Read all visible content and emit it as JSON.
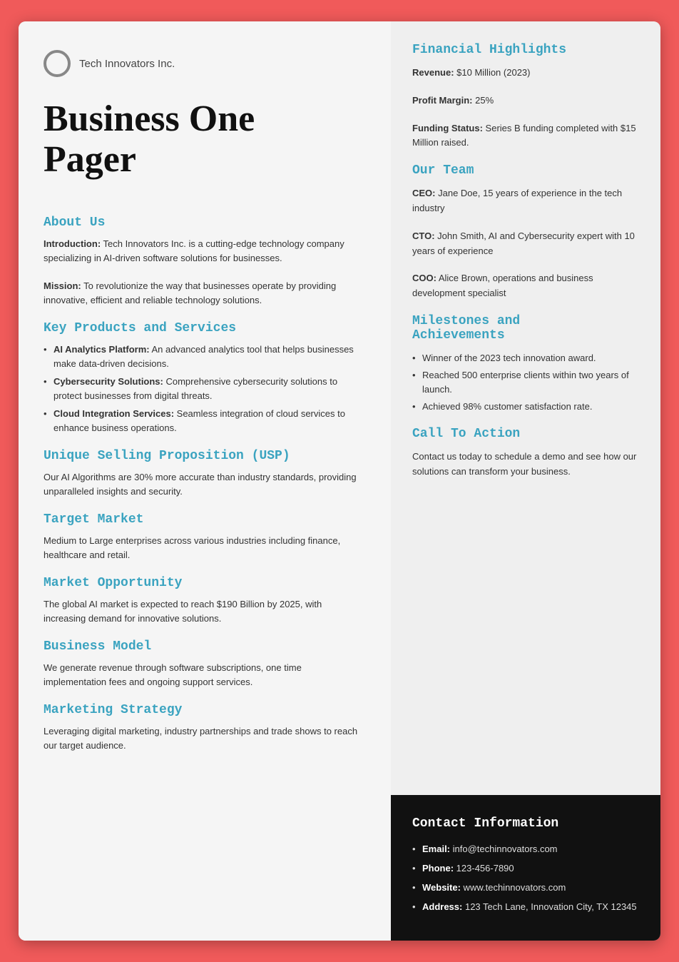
{
  "company": {
    "name": "Tech Innovators Inc.",
    "logo_alt": "circle logo"
  },
  "header": {
    "title_line1": "Business One",
    "title_line2": "Pager"
  },
  "left": {
    "about_us": {
      "heading": "About Us",
      "intro_label": "Introduction:",
      "intro_text": "Tech Innovators Inc. is a cutting-edge technology company specializing in AI-driven software solutions for businesses.",
      "mission_label": "Mission:",
      "mission_text": "To revolutionize the way that businesses operate by providing innovative, efficient and reliable technology solutions."
    },
    "key_products": {
      "heading": "Key Products and Services",
      "items": [
        {
          "label": "AI Analytics Platform:",
          "text": "An advanced analytics tool that helps businesses make data-driven decisions."
        },
        {
          "label": "Cybersecurity Solutions:",
          "text": "Comprehensive cybersecurity solutions to protect businesses from digital threats."
        },
        {
          "label": "Cloud Integration Services:",
          "text": "Seamless integration of cloud services to enhance business operations."
        }
      ]
    },
    "usp": {
      "heading": "Unique Selling Proposition (USP)",
      "text": "Our AI Algorithms are 30% more accurate than industry standards, providing unparalleled insights and security."
    },
    "target_market": {
      "heading": "Target Market",
      "text": "Medium to Large enterprises across various industries including finance, healthcare and retail."
    },
    "market_opportunity": {
      "heading": "Market Opportunity",
      "text": "The global AI market is expected to reach $190 Billion by 2025, with increasing demand for innovative solutions."
    },
    "business_model": {
      "heading": "Business Model",
      "text": "We generate revenue through software subscriptions, one time implementation fees and ongoing support services."
    },
    "marketing_strategy": {
      "heading": "Marketing Strategy",
      "text": "Leveraging digital marketing, industry partnerships and trade shows to reach our target audience."
    }
  },
  "right": {
    "financial": {
      "heading": "Financial Highlights",
      "items": [
        {
          "label": "Revenue:",
          "text": "$10 Million (2023)"
        },
        {
          "label": "Profit Margin:",
          "text": "25%"
        },
        {
          "label": "Funding Status:",
          "text": "Series B funding completed with $15 Million raised."
        }
      ]
    },
    "team": {
      "heading": "Our Team",
      "members": [
        {
          "label": "CEO:",
          "text": "Jane Doe, 15 years of experience in the tech industry"
        },
        {
          "label": "CTO:",
          "text": "John Smith, AI and Cybersecurity expert with 10 years of experience"
        },
        {
          "label": "COO:",
          "text": "Alice Brown, operations and business development specialist"
        }
      ]
    },
    "milestones": {
      "heading": "Milestones and Achievements",
      "items": [
        "Winner of the 2023 tech innovation award.",
        "Reached 500 enterprise clients within two years of launch.",
        "Achieved 98% customer satisfaction rate."
      ]
    },
    "cta": {
      "heading": "Call To Action",
      "text": "Contact us today to schedule a demo and see how our solutions can transform your business."
    }
  },
  "contact": {
    "heading": "Contact Information",
    "items": [
      {
        "label": "Email:",
        "text": "info@techinnovators.com"
      },
      {
        "label": "Phone:",
        "text": "123-456-7890"
      },
      {
        "label": "Website:",
        "text": "www.techinnovators.com"
      },
      {
        "label": "Address:",
        "text": "123 Tech Lane, Innovation City, TX 12345"
      }
    ]
  }
}
